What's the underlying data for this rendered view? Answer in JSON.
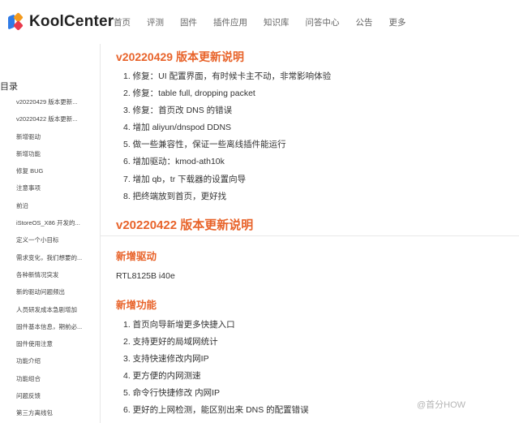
{
  "header": {
    "logo_text": "KoolCenter",
    "nav": [
      "首页",
      "评测",
      "固件",
      "插件应用",
      "知识库",
      "问答中心",
      "公告",
      "更多"
    ]
  },
  "sidebar": {
    "title": "目录",
    "items": [
      "v20220429 版本更新...",
      "v20220422 版本更新...",
      "新增驱动",
      "新增功能",
      "修复 BUG",
      "注意事项",
      "前沿",
      "iStoreOS_X86 开发的...",
      "定义一个小目标",
      "需求变化，我们想要的...",
      "各种新情况突发",
      "新的驱动问题频出",
      "人员研发成本急剧增加",
      "固件基本信息，期前必...",
      "固件使用注意",
      "功能介绍",
      "功能组合",
      "问题反馈",
      "第三方离线包"
    ]
  },
  "main": {
    "v1_title": "v20220429 版本更新说明",
    "v1_items": [
      "1. 修复：UI 配置界面，有时候卡主不动，非常影响体验",
      "2. 修复：table full, dropping packet",
      "3. 修复：首页改 DNS 的错误",
      "4. 增加 aliyun/dnspod DDNS",
      "5. 做一些兼容性，保证一些离线插件能运行",
      "6. 增加驱动：kmod-ath10k",
      "7. 增加 qb，tr 下载器的设置向导",
      "8. 把终端放到首页，更好找"
    ],
    "v2_title": "v20220422 版本更新说明",
    "drivers_title": "新增驱动",
    "drivers_text": "RTL8125B i40e",
    "features_title": "新增功能",
    "features_items": [
      "1. 首页向导新增更多快捷入口",
      "2. 支持更好的局域网统计",
      "3. 支持快速修改内网IP",
      "4. 更方便的内网测速",
      "5. 命令行快捷修改 内网IP",
      "6. 更好的上网检测，能区别出来 DNS 的配置错误"
    ]
  },
  "watermark": "@首分HOW",
  "colors": {
    "accent": "#e8632a",
    "text": "#333333"
  }
}
